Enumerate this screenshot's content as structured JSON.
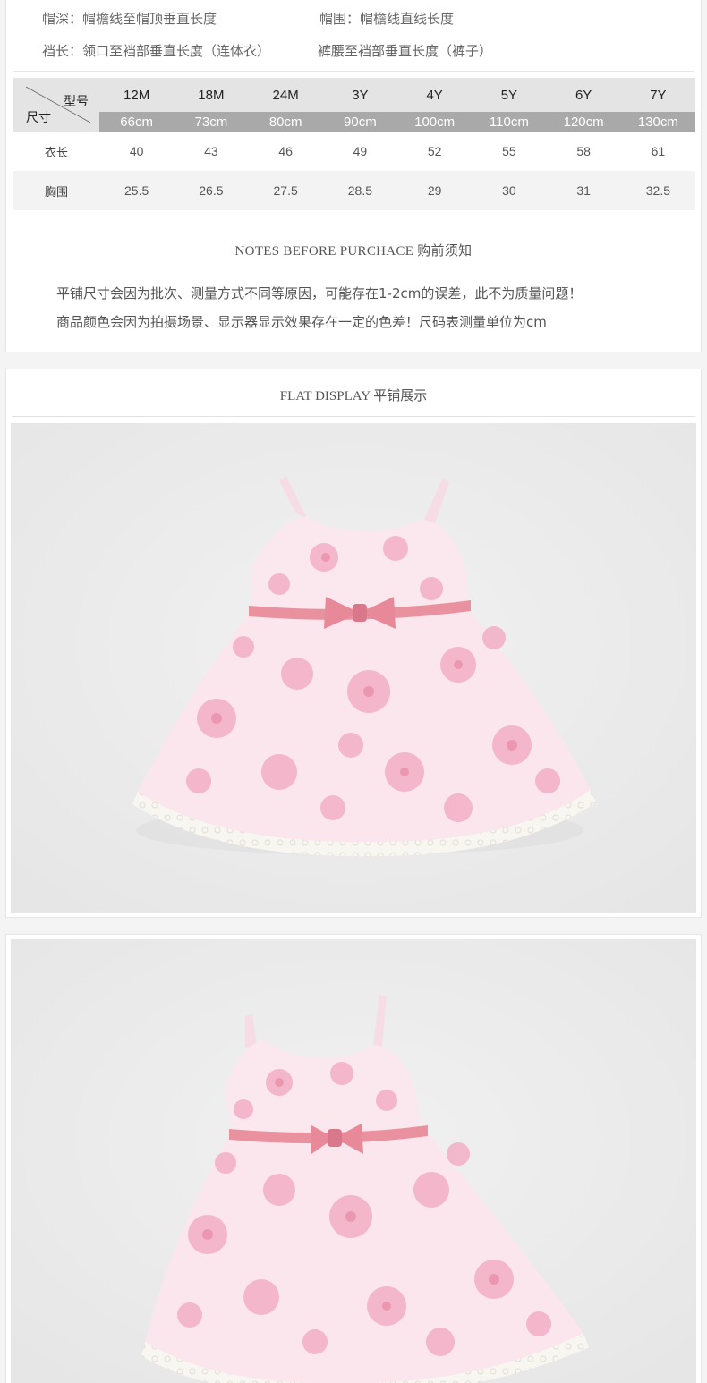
{
  "definitions": [
    {
      "term": "帽深：",
      "desc": "帽檐线至帽顶垂直长度"
    },
    {
      "term": "帽围：",
      "desc": "帽檐线直线长度"
    },
    {
      "term": "裆长：",
      "desc": "领口至裆部垂直长度（连体衣）"
    },
    {
      "term": "",
      "desc": "裤腰至裆部垂直长度（裤子）"
    }
  ],
  "size_table": {
    "corner_model": "型号",
    "corner_size": "尺寸",
    "sizes": [
      "12M",
      "18M",
      "24M",
      "3Y",
      "4Y",
      "5Y",
      "6Y",
      "7Y"
    ],
    "heights": [
      "66cm",
      "73cm",
      "80cm",
      "90cm",
      "100cm",
      "110cm",
      "120cm",
      "130cm"
    ],
    "rows": [
      {
        "name": "衣长",
        "values": [
          "40",
          "43",
          "46",
          "49",
          "52",
          "55",
          "58",
          "61"
        ]
      },
      {
        "name": "胸围",
        "values": [
          "25.5",
          "26.5",
          "27.5",
          "28.5",
          "29",
          "30",
          "31",
          "32.5"
        ]
      }
    ]
  },
  "notes": {
    "title": "NOTES BEFORE PURCHACE 购前须知",
    "lines": [
      "平铺尺寸会因为批次、测量方式不同等原因，可能存在1-2cm的误差，此不为质量问题！",
      "商品颜色会因为拍摄场景、显示器显示效果存在一定的色差！尺码表测量单位为cm"
    ]
  },
  "flat_display": {
    "title": "FLAT DISPLAY 平铺展示"
  },
  "colors": {
    "header_bg": "#e4e4e4",
    "subheader_bg": "#a9a9a9",
    "dress_pink": "#f2b3c6",
    "bow_pink": "#e58e9e",
    "lace": "#f7f5f0"
  }
}
